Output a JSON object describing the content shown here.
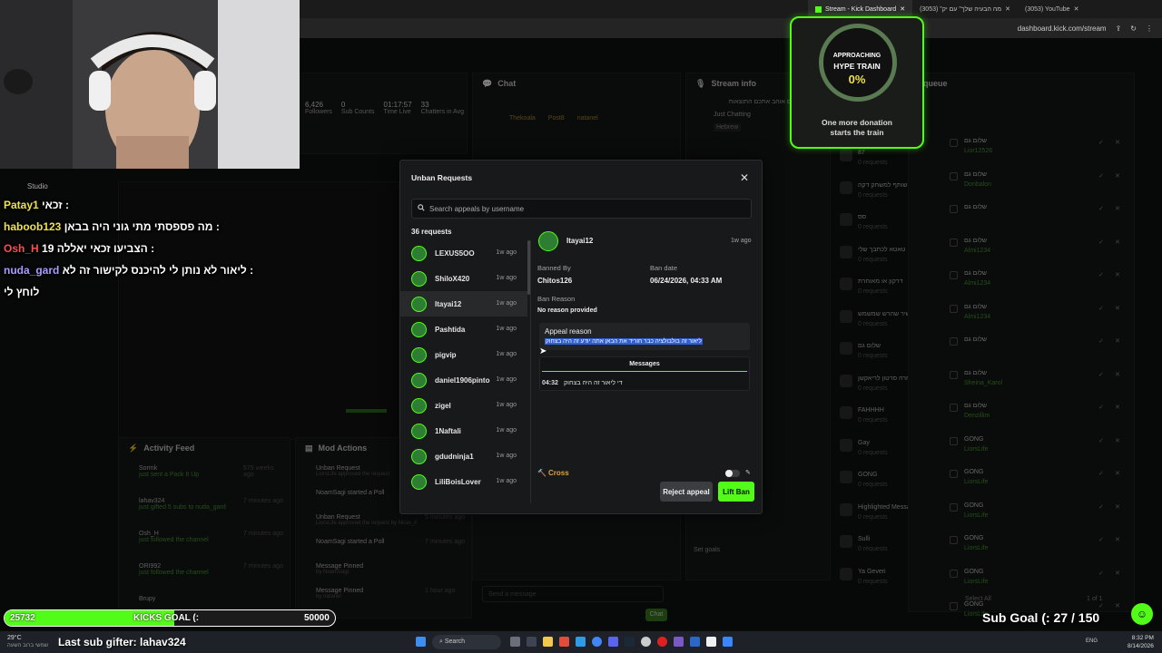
{
  "browser": {
    "tabs": [
      {
        "label": "Stream - Kick Dashboard",
        "active": true
      },
      {
        "label": "(3053) \"מה הבעיה שלך\" עם יק",
        "active": false
      },
      {
        "label": "(3053) YouTube",
        "active": false
      }
    ],
    "url": "dashboard.kick.com/stream"
  },
  "dashboard": {
    "stats": [
      {
        "value": "6,426",
        "label": "Followers"
      },
      {
        "value": "0",
        "label": "Sub Counts"
      },
      {
        "value": "01:17:57",
        "label": "Time Live"
      },
      {
        "value": "33",
        "label": "Chatters in Avg"
      }
    ],
    "chat_title": "Chat",
    "chat_users": [
      "Thekoala",
      "Post8",
      "natanel"
    ],
    "stream_info_title": "Stream info",
    "stream_info_title_text": "רגוע אחרי ים אוהב אתכם התוצאות",
    "stream_category": "Just Chatting",
    "stream_language": "Hebrew",
    "queue_title": "queue",
    "studio_label": "Studio",
    "activity_feed_title": "Activity Feed",
    "mod_actions_title": "Mod Actions",
    "activity_items": [
      {
        "name": "Sormk",
        "sub": "just sent a Pack It Up",
        "time": "575 weeks ago"
      },
      {
        "name": "lahav324",
        "sub": "just gifted 5 subs to nuda_gard",
        "time": "7 minutes ago"
      },
      {
        "name": "Osh_H",
        "sub": "just followed the channel",
        "time": "7 minutes ago"
      },
      {
        "name": "ORI992",
        "sub": "just followed the channel",
        "time": "7 minutes ago"
      },
      {
        "name": "Brupy",
        "sub": "",
        "time": ""
      }
    ],
    "mod_items": [
      {
        "title": "Unban Request",
        "sub": "LiorsLife approved the request",
        "time": "3 minutes ago"
      },
      {
        "title": "NoamSagi started a Poll",
        "sub": "",
        "time": "7 minutes ago"
      },
      {
        "title": "Unban Request",
        "sub": "LiorsLife approved the request by Nirax_0",
        "time": "5 minutes ago"
      },
      {
        "title": "NoamSagi started a Poll",
        "sub": "",
        "time": "7 minutes ago"
      },
      {
        "title": "Message Pinned",
        "sub": "by NoamSagi",
        "time": ""
      },
      {
        "title": "Message Pinned",
        "sub": "by natanel",
        "time": "1 hour ago"
      }
    ],
    "mid_items": [
      {
        "title": "87",
        "sub": "0 requests"
      },
      {
        "title": "לאואר שותף למשחק דקה",
        "sub": "0 requests"
      },
      {
        "title": "סס",
        "sub": "0 requests"
      },
      {
        "title": "טאטא לכתבך שלי",
        "sub": "0 requests"
      },
      {
        "title": "דרקון או מאוחרת",
        "sub": "0 requests"
      },
      {
        "title": "שיר שהרש שמשמש",
        "sub": "0 requests"
      },
      {
        "title": "שלום גם",
        "sub": "0 requests"
      },
      {
        "title": "הבחרה סרטון לריאקשן",
        "sub": "0 requests"
      },
      {
        "title": "FAHHHH",
        "sub": "0 requests"
      },
      {
        "title": "Gay",
        "sub": "0 requests"
      },
      {
        "title": "GONG",
        "sub": "0 requests"
      },
      {
        "title": "Highlighted Message",
        "sub": "0 requests"
      },
      {
        "title": "Sulli",
        "sub": "0 requests"
      },
      {
        "title": "Ya Geveri",
        "sub": "0 requests"
      }
    ],
    "queue_items": [
      {
        "name": "שלום גם",
        "sub": "Lior12526"
      },
      {
        "name": "שלום גם",
        "sub": "Donbalon"
      },
      {
        "name": "שלום גם",
        "sub": ""
      },
      {
        "name": "שלום גם",
        "sub": "Almi1234"
      },
      {
        "name": "שלום גם",
        "sub": "Almi1234"
      },
      {
        "name": "שלום גם",
        "sub": "Almi1234"
      },
      {
        "name": "שלום גם",
        "sub": ""
      },
      {
        "name": "שלום גם",
        "sub": "Sheina_Karol"
      },
      {
        "name": "שלום גם",
        "sub": "Denzillim"
      },
      {
        "name": "GONG",
        "sub": "LiorsLife"
      },
      {
        "name": "GONG",
        "sub": "LiorsLife"
      },
      {
        "name": "GONG",
        "sub": "LiorsLife"
      },
      {
        "name": "GONG",
        "sub": "LiorsLife"
      },
      {
        "name": "GONG",
        "sub": "LiorsLife"
      },
      {
        "name": "GONG",
        "sub": "LiorsLife"
      }
    ],
    "queue_select_all": "Select All",
    "queue_page": "1 of 1",
    "set_goals": "Set goals",
    "chat_input_placeholder": "Send a message",
    "chat_send": "Chat"
  },
  "hype_train": {
    "line1": "APPROACHING",
    "line2": "HYPE TRAIN",
    "percent": "0%",
    "footer": "One more donation starts the train"
  },
  "overlay_chat": [
    {
      "user": "Pataу1",
      "text": ": זכאי",
      "color": "#f0e442"
    },
    {
      "user": "haboob123",
      "text": ": מה פספסתי מתי גוני היה בבאן",
      "color": "#f0e442"
    },
    {
      "user": "Osh_H",
      "text": ": הצביעו זכאי יאללה 19",
      "color": "#ff4d4d"
    },
    {
      "user": "nuda_gard",
      "text": ": ליאור לא נותן לי להיכנס לקישור זה לא",
      "color": "#a89cff"
    },
    {
      "user": "",
      "text": "לוחץ לי",
      "color": "#ffffff"
    }
  ],
  "modal": {
    "title": "Unban Requests",
    "search_placeholder": "Search appeals by username",
    "count": "36 requests",
    "requests": [
      {
        "name": "LEXUS5OO",
        "time": "1w ago"
      },
      {
        "name": "ShiloX420",
        "time": "1w ago"
      },
      {
        "name": "Itayai12",
        "time": "1w ago"
      },
      {
        "name": "Pashtida",
        "time": "1w ago"
      },
      {
        "name": "pigvip",
        "time": "1w ago"
      },
      {
        "name": "daniel1906pinto",
        "time": "1w ago"
      },
      {
        "name": "zigel",
        "time": "1w ago"
      },
      {
        "name": "1Naftali",
        "time": "1w ago"
      },
      {
        "name": "gdudninja1",
        "time": "1w ago"
      },
      {
        "name": "LiliBoisLover",
        "time": "1w ago"
      }
    ],
    "selected_index": 2,
    "detail": {
      "username": "Itayai12",
      "time": "1w ago",
      "banned_by_label": "Banned By",
      "banned_by": "Chitos126",
      "ban_date_label": "Ban date",
      "ban_date": "06/24/2026, 04:33 AM",
      "ban_reason_label": "Ban Reason",
      "ban_reason": "No reason provided",
      "appeal_reason_label": "Appeal reason",
      "appeal_reason": "ליאור זה בולבולציה כבר חוריד את הבאן אתה יודע זה היה בצחוק",
      "messages_label": "Messages",
      "message_time": "04:32",
      "message_text": "די ליאור זה היה בצחוק",
      "cross_label": "Cross",
      "reject_label": "Reject appeal",
      "lift_label": "Lift Ban"
    }
  },
  "overlay_bottom": {
    "kicks_current": "25732",
    "kicks_label": "KICKS GOAL (:",
    "kicks_target": "50000",
    "kicks_fraction": 0.5146,
    "sub_goal": "Sub Goal (: 27 / 150",
    "last_sub": "Last sub gifter: lahav324"
  },
  "taskbar": {
    "weather_temp": "29°C",
    "weather_desc": "שמשי ברוב השעה",
    "search": "Search",
    "time": "8:32 PM",
    "date": "8/14/2026",
    "lang": "ENG"
  }
}
